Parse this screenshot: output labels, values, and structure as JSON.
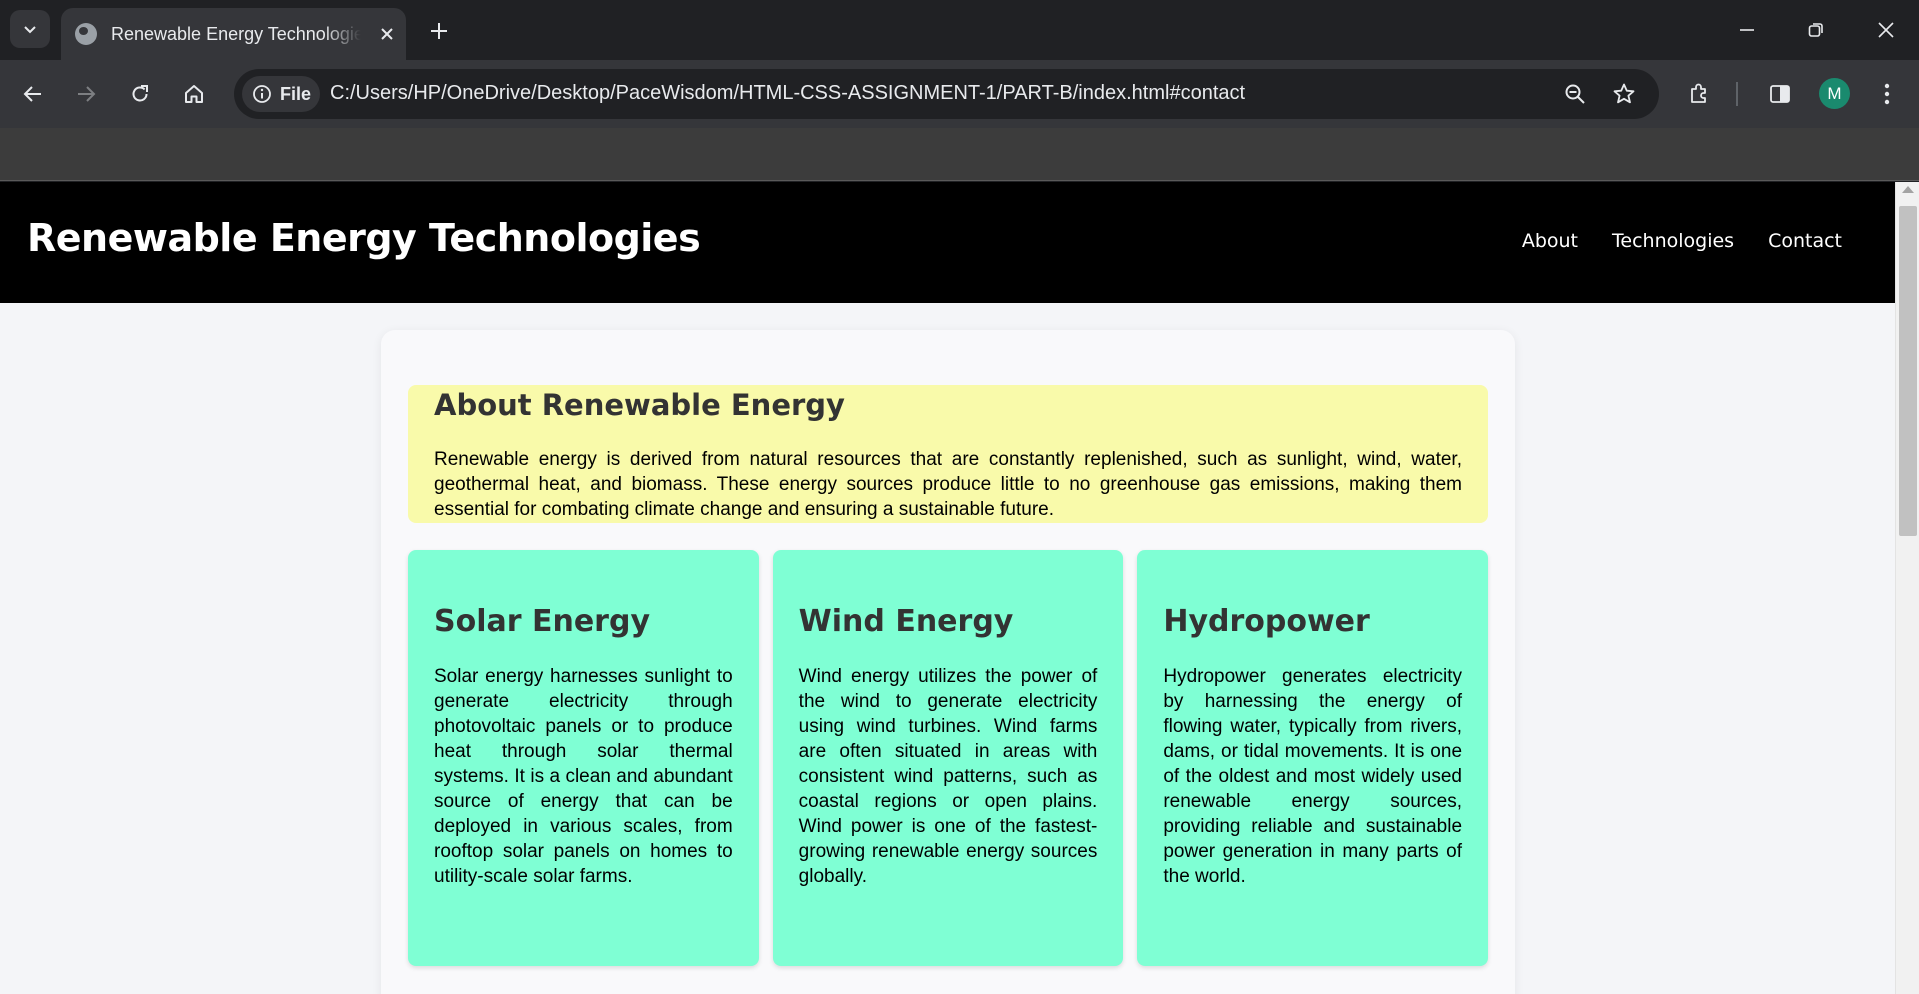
{
  "browser": {
    "tab_title": "Renewable Energy Technologies",
    "site_chip_label": "File",
    "url": "C:/Users/HP/OneDrive/Desktop/PaceWisdom/HTML-CSS-ASSIGNMENT-1/PART-B/index.html#contact",
    "profile_initial": "M",
    "icons": [
      "tab-search-icon",
      "globe-icon",
      "close-icon",
      "plus-icon",
      "minimize-icon",
      "restore-icon",
      "window-close-icon",
      "back-arrow-icon",
      "forward-arrow-icon",
      "reload-icon",
      "home-icon",
      "info-icon",
      "zoom-out-icon",
      "star-icon",
      "extensions-icon",
      "side-panel-icon",
      "more-vert-icon"
    ],
    "colors": {
      "tabstrip": "#202124",
      "toolbar": "#35363a",
      "avatar": "#1a8a6e"
    }
  },
  "page": {
    "site_title": "Renewable Energy Technologies",
    "nav": {
      "about": "About",
      "technologies": "Technologies",
      "contact": "Contact"
    },
    "about": {
      "heading": "About Renewable Energy",
      "text": "Renewable energy is derived from natural resources that are constantly replenished, such as sunlight, wind, water, geothermal heat, and biomass. These energy sources produce little to no greenhouse gas emissions, making them essential for combating climate change and ensuring a sustainable future."
    },
    "cards": [
      {
        "heading": "Solar Energy",
        "text": "Solar energy harnesses sunlight to generate electricity through photovoltaic panels or to produce heat through solar thermal systems. It is a clean and abundant source of energy that can be deployed in various scales, from rooftop solar panels on homes to utility-scale solar farms."
      },
      {
        "heading": "Wind Energy",
        "text": "Wind energy utilizes the power of the wind to generate electricity using wind turbines. Wind farms are often situated in areas with consistent wind patterns, such as coastal regions or open plains. Wind power is one of the fastest-growing renewable energy sources globally."
      },
      {
        "heading": "Hydropower",
        "text": "Hydropower generates electricity by harnessing the energy of flowing water, typically from rivers, dams, or tidal movements. It is one of the oldest and most widely used renewable energy sources, providing reliable and sustainable power generation in many parts of the world."
      }
    ],
    "colors": {
      "header": "#000000",
      "about_bg": "#f9faaa",
      "card_bg": "#7fffd4",
      "page_bg": "#f4f5f8"
    }
  }
}
